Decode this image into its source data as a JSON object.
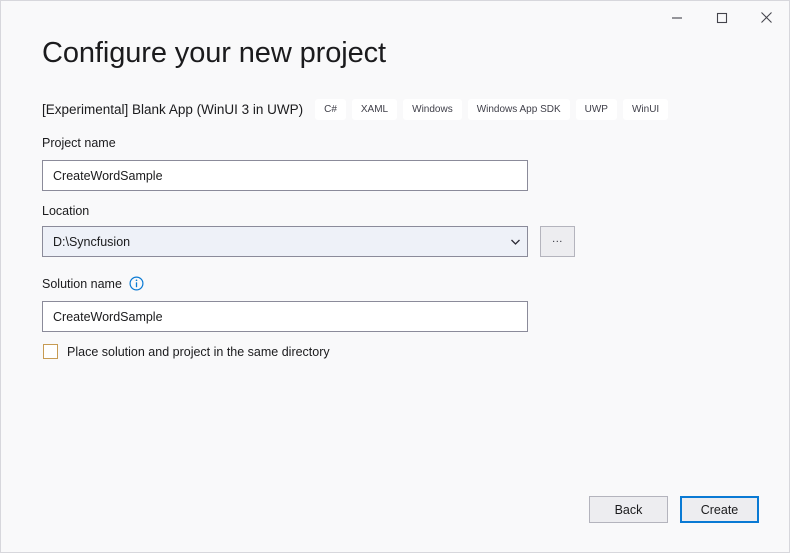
{
  "window": {
    "titlebar": {
      "minimize_label": "Minimize",
      "maximize_label": "Maximize",
      "close_label": "Close"
    }
  },
  "header": {
    "title": "Configure your new project",
    "template_name": "[Experimental] Blank App (WinUI 3 in UWP)",
    "tags": [
      "C#",
      "XAML",
      "Windows",
      "Windows App SDK",
      "UWP",
      "WinUI"
    ]
  },
  "form": {
    "project_name": {
      "label": "Project name",
      "value": "CreateWordSample",
      "placeholder": ""
    },
    "location": {
      "label": "Location",
      "value": "D:\\Syncfusion",
      "browse_label": "...",
      "dropdown_icon": "chevron-down-icon"
    },
    "solution_name": {
      "label": "Solution name",
      "value": "CreateWordSample",
      "placeholder": "",
      "info_icon": "info-icon"
    },
    "same_directory": {
      "label": "Place solution and project in the same directory",
      "checked": false
    }
  },
  "footer": {
    "back_label": "Back",
    "create_label": "Create"
  },
  "colors": {
    "accent": "#0a7ad4",
    "page_background": "#f9f9fa",
    "input_border": "#8b8b9a",
    "checkbox_border": "#c79b52",
    "info_icon": "#0a7ad4"
  }
}
